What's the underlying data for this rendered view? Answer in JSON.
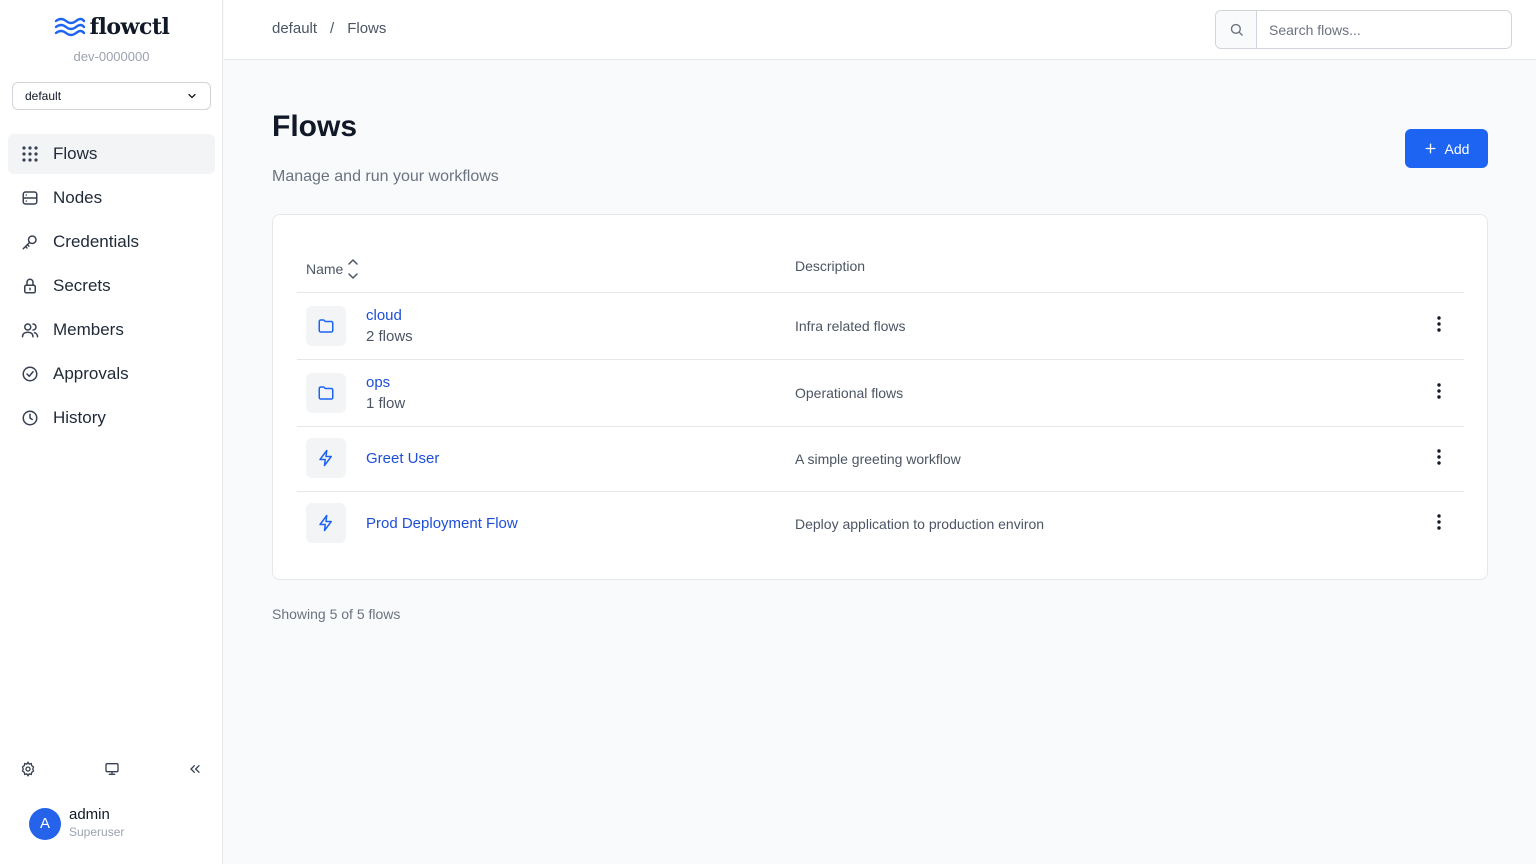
{
  "brand": {
    "name": "flowctl",
    "instance": "dev-0000000"
  },
  "namespace": {
    "selected": "default"
  },
  "nav": {
    "items": [
      {
        "label": "Flows",
        "icon": "grid-icon",
        "active": true
      },
      {
        "label": "Nodes",
        "icon": "server-icon"
      },
      {
        "label": "Credentials",
        "icon": "key-icon"
      },
      {
        "label": "Secrets",
        "icon": "lock-icon"
      },
      {
        "label": "Members",
        "icon": "users-icon"
      },
      {
        "label": "Approvals",
        "icon": "check-circle-icon"
      },
      {
        "label": "History",
        "icon": "clock-icon"
      }
    ]
  },
  "user": {
    "initial": "A",
    "name": "admin",
    "role": "Superuser"
  },
  "breadcrumb": {
    "root": "default",
    "separator": "/",
    "current": "Flows"
  },
  "search": {
    "placeholder": "Search flows..."
  },
  "page": {
    "title": "Flows",
    "subtitle": "Manage and run your workflows",
    "add_label": "Add"
  },
  "table": {
    "headers": {
      "name": "Name",
      "description": "Description"
    },
    "rows": [
      {
        "type": "folder",
        "name": "cloud",
        "count": "2 flows",
        "description": "Infra related flows"
      },
      {
        "type": "folder",
        "name": "ops",
        "count": "1 flow",
        "description": "Operational flows"
      },
      {
        "type": "flow",
        "name": "Greet User",
        "description": "A simple greeting workflow"
      },
      {
        "type": "flow",
        "name": "Prod Deployment Flow",
        "description": "Deploy application to production environ"
      }
    ]
  },
  "footer": {
    "showing": "Showing 5 of 5 flows"
  },
  "colors": {
    "accent": "#1d64f2",
    "link": "#1d4ed8",
    "sidebar_active": "#f3f4f6"
  }
}
